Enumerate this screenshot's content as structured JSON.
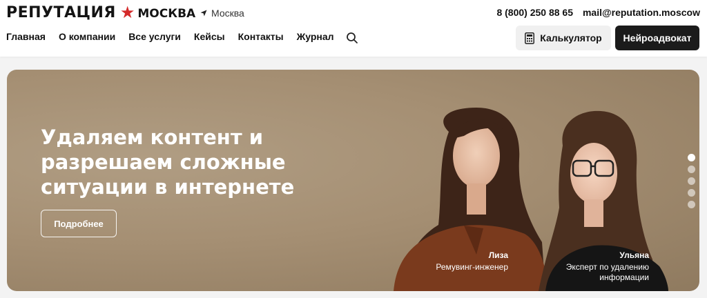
{
  "header": {
    "logo_main": "РЕПУТАЦИЯ",
    "logo_star": "★",
    "logo_sub": "МОСКВА",
    "city": "Москва",
    "phone": "8 (800) 250 88 65",
    "email": "mail@reputation.moscow"
  },
  "nav": {
    "items": [
      "Главная",
      "О компании",
      "Все услуги",
      "Кейсы",
      "Контакты",
      "Журнал"
    ]
  },
  "buttons": {
    "calculator": "Калькулятор",
    "neuro_lawyer": "Нейроадвокат"
  },
  "hero": {
    "title": "Удаляем контент и разрешаем сложные ситуации в интернете",
    "cta": "Подробнее",
    "person1_name": "Лиза",
    "person1_role": "Ремувинг-инженер",
    "person2_name": "Ульяна",
    "person2_role": "Эксперт по удалению информации",
    "slides_count": 5,
    "active_slide": 1
  },
  "colors": {
    "brand_red": "#d42a2a",
    "dark_button": "#1b1b1b",
    "hero_bg": "#a58f73"
  }
}
